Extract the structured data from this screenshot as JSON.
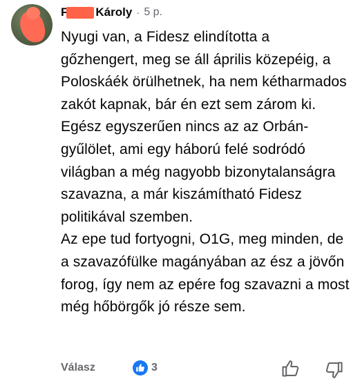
{
  "comment": {
    "author_first_initial": "F",
    "author_last": "Károly",
    "separator": "·",
    "time": "5 p.",
    "paragraphs": [
      "Nyugi van, a Fidesz elindította a gőzhengert, meg se áll április közepéig, a Poloskáék örülhetnek, ha nem kétharmados zakót kapnak, bár én ezt sem zárom ki.",
      "Egész egyszerűen nincs az az Orbán-gyűlölet, ami egy háború felé sodródó világban a még nagyobb bizonytalanságra szavazna, a már kiszámítható Fidesz politikával szemben.",
      "Az epe tud fortyogni, O1G, meg minden, de a szavazófülke magányában az ész a jövőn forog, így nem az epére fog szavazni a most még hőbörgők jó része sem."
    ]
  },
  "actions": {
    "reply_label": "Válasz",
    "like_count": "3"
  },
  "colors": {
    "like_blue": "#1877f2",
    "muted_text": "#65676b",
    "redaction": "#ff6347"
  },
  "icons": {
    "like_badge": "thumbs-up-icon",
    "react_like": "thumbs-up-outline-icon",
    "react_dislike": "thumbs-down-outline-icon"
  }
}
